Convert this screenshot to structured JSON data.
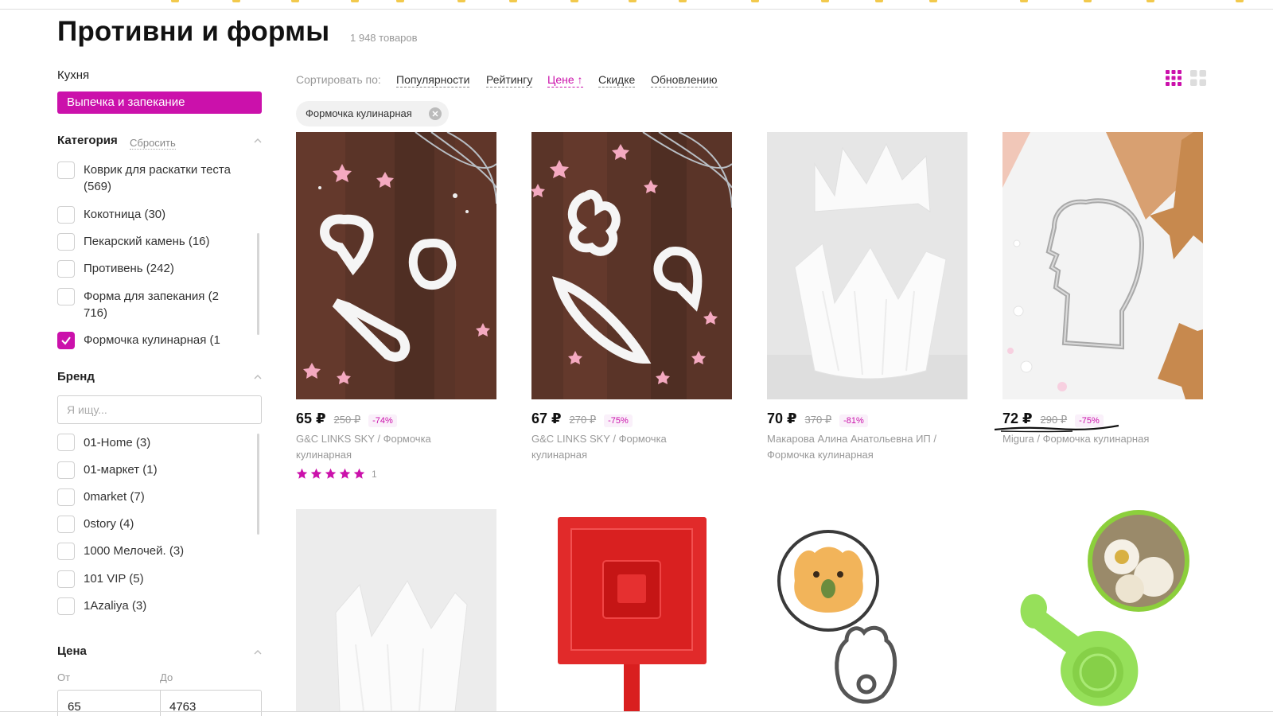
{
  "page": {
    "title": "Противни и формы",
    "count": "1 948 товаров"
  },
  "sidebar": {
    "kitchen_label": "Кухня",
    "kitchen_selected": "Выпечка и запекание",
    "category": {
      "label": "Категория",
      "reset": "Сбросить",
      "items": [
        {
          "label": "Коврик для раскатки теста (569)",
          "checked": false
        },
        {
          "label": "Кокотница (30)",
          "checked": false
        },
        {
          "label": "Пекарский камень (16)",
          "checked": false
        },
        {
          "label": "Противень (242)",
          "checked": false
        },
        {
          "label": "Форма для запекания (2 716)",
          "checked": false
        },
        {
          "label": "Формочка кулинарная (1",
          "checked": true
        }
      ]
    },
    "brand": {
      "label": "Бренд",
      "placeholder": "Я ищу...",
      "items": [
        {
          "label": "01-Home (3)"
        },
        {
          "label": "01-маркет (1)"
        },
        {
          "label": "0market (7)"
        },
        {
          "label": "0story (4)"
        },
        {
          "label": "1000 Мелочей. (3)"
        },
        {
          "label": "101 VIP (5)"
        },
        {
          "label": "1Azaliya (3)"
        }
      ]
    },
    "price": {
      "label": "Цена",
      "from_label": "От",
      "to_label": "До",
      "from_value": "65",
      "to_value": "4763"
    }
  },
  "sort": {
    "label": "Сортировать по:",
    "options": [
      "Популярности",
      "Рейтингу",
      "Цене ↑",
      "Скидке",
      "Обновлению"
    ],
    "active": "Цене ↑"
  },
  "active_filter": "Формочка кулинарная",
  "products": [
    {
      "price": "65 ₽",
      "old_price": "250 ₽",
      "discount": "-74%",
      "brand_line1": "G&C LINKS SKY / Формочка",
      "brand_line2": "кулинарная",
      "rating_count": "1",
      "stars": 5
    },
    {
      "price": "67 ₽",
      "old_price": "270 ₽",
      "discount": "-75%",
      "brand_line1": "G&C LINKS SKY / Формочка",
      "brand_line2": "кулинарная"
    },
    {
      "price": "70 ₽",
      "old_price": "370 ₽",
      "discount": "-81%",
      "brand_line1": "Макарова Алина Анатольевна ИП /",
      "brand_line2": "Формочка кулинарная"
    },
    {
      "price": "72 ₽",
      "old_price": "290 ₽",
      "discount": "-75%",
      "brand_line1": "Migura / Формочка кулинарная",
      "brand_line2": ""
    }
  ],
  "colors": {
    "accent": "#cb11ab",
    "muted": "#999999"
  }
}
